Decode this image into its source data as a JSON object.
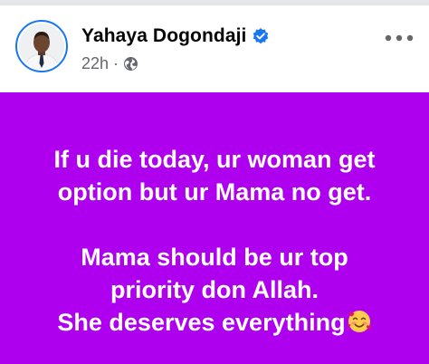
{
  "post": {
    "author": "Yahaya Dogondaji",
    "time": "22h",
    "separator": "·",
    "background_color": "#ae00ef",
    "paragraph_1": "If u die today, ur woman get\noption but ur Mama  no get.",
    "paragraph_2_lines": "Mama should be ur top\npriority don Allah.\nShe deserves everything",
    "emoji": "smiling-face-with-hearts"
  },
  "icons": {
    "verified": "verified-badge-icon",
    "privacy": "globe-icon",
    "more": "more-options-icon"
  },
  "colors": {
    "verified_blue": "#1877f2",
    "meta_gray": "#65676b",
    "name_black": "#050505"
  }
}
